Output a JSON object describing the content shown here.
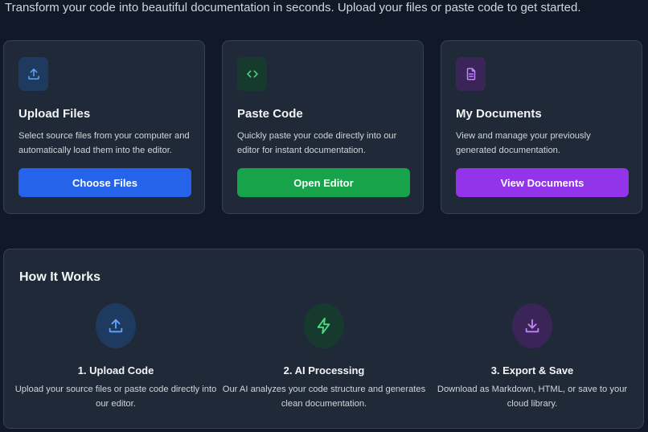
{
  "intro": "Transform your code into beautiful documentation in seconds. Upload your files or paste code to get started.",
  "cards": [
    {
      "icon": "upload-icon",
      "title": "Upload Files",
      "description": "Select source files from your computer and automatically load them into the editor.",
      "button": "Choose Files",
      "accent": "#2563eb",
      "icon_color": "#60a5fa",
      "icon_bg": "#1e3a5f"
    },
    {
      "icon": "code-icon",
      "title": "Paste Code",
      "description": "Quickly paste your code directly into our editor for instant documentation.",
      "button": "Open Editor",
      "accent": "#16a34a",
      "icon_color": "#4ade80",
      "icon_bg": "#163a2e"
    },
    {
      "icon": "document-icon",
      "title": "My Documents",
      "description": "View and manage your previously generated documentation.",
      "button": "View Documents",
      "accent": "#9333ea",
      "icon_color": "#c084fc",
      "icon_bg": "#3b2558"
    }
  ],
  "how_it_works": {
    "heading": "How It Works",
    "steps": [
      {
        "icon": "upload-icon",
        "title": "1. Upload Code",
        "description": "Upload your source files or paste code directly into our editor.",
        "icon_color": "#60a5fa",
        "icon_bg": "#1e3a5f"
      },
      {
        "icon": "lightning-icon",
        "title": "2. AI Processing",
        "description": "Our AI analyzes your code structure and generates clean documentation.",
        "icon_color": "#4ade80",
        "icon_bg": "#163a2e"
      },
      {
        "icon": "download-icon",
        "title": "3. Export & Save",
        "description": "Download as Markdown, HTML, or save to your cloud library.",
        "icon_color": "#c084fc",
        "icon_bg": "#3b2558"
      }
    ]
  }
}
